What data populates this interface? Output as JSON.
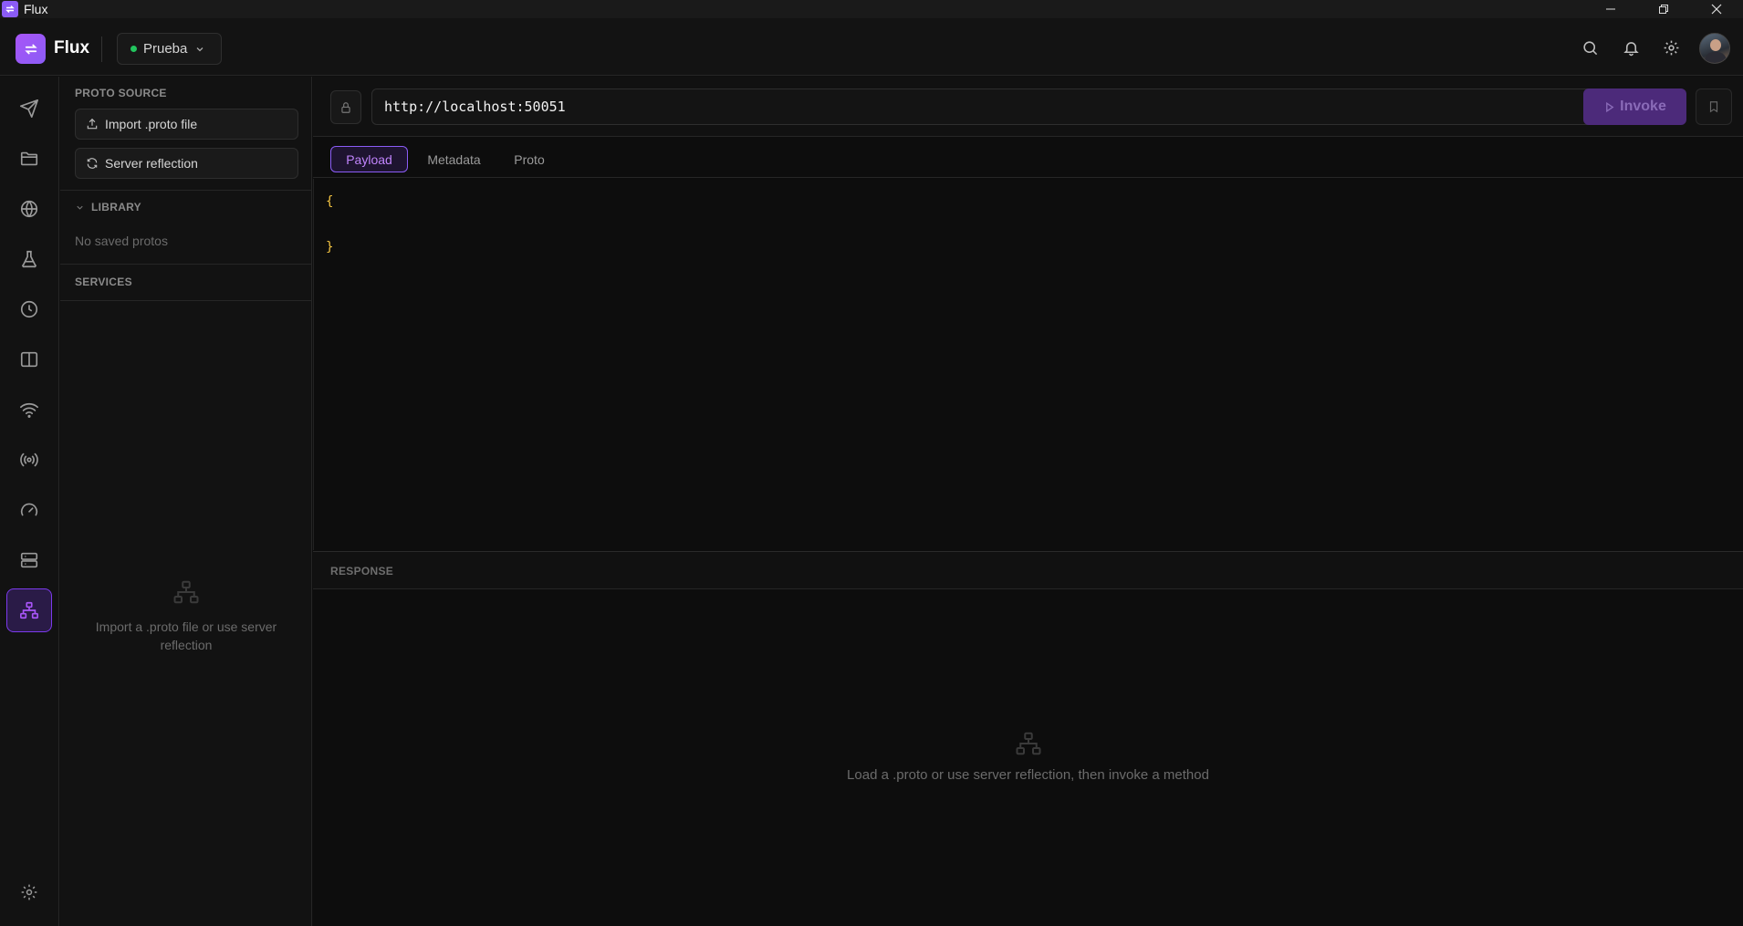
{
  "window": {
    "title": "Flux"
  },
  "header": {
    "brand": "Flux",
    "environment": {
      "name": "Prueba",
      "status_color": "#22c55e"
    },
    "icons": [
      "search-icon",
      "bell-icon",
      "gear-icon"
    ]
  },
  "rail": {
    "items": [
      {
        "name": "send-icon"
      },
      {
        "name": "folder-icon"
      },
      {
        "name": "globe-icon"
      },
      {
        "name": "flask-icon"
      },
      {
        "name": "clock-icon"
      },
      {
        "name": "columns-icon"
      },
      {
        "name": "wifi-icon"
      },
      {
        "name": "broadcast-icon"
      },
      {
        "name": "gauge-icon"
      },
      {
        "name": "server-icon"
      },
      {
        "name": "hierarchy-icon",
        "active": true
      }
    ],
    "bottom": "gear-icon"
  },
  "side": {
    "proto_source_label": "PROTO SOURCE",
    "import_button": "Import .proto file",
    "reflection_button": "Server reflection",
    "library_label": "LIBRARY",
    "library_empty": "No saved protos",
    "services_label": "SERVICES",
    "services_empty": "Import a .proto file or use server reflection"
  },
  "request": {
    "url": "http://localhost:50051",
    "invoke_label": "Invoke",
    "tabs": [
      {
        "label": "Payload",
        "active": true
      },
      {
        "label": "Metadata",
        "active": false
      },
      {
        "label": "Proto",
        "active": false
      }
    ],
    "payload_lines": [
      "{",
      "}"
    ]
  },
  "response": {
    "label": "RESPONSE",
    "empty_text": "Load a .proto or use server reflection, then invoke a method"
  },
  "colors": {
    "accent": "#8b5cf6",
    "background": "#0f0f0f",
    "json_brace": "#f5c542"
  }
}
